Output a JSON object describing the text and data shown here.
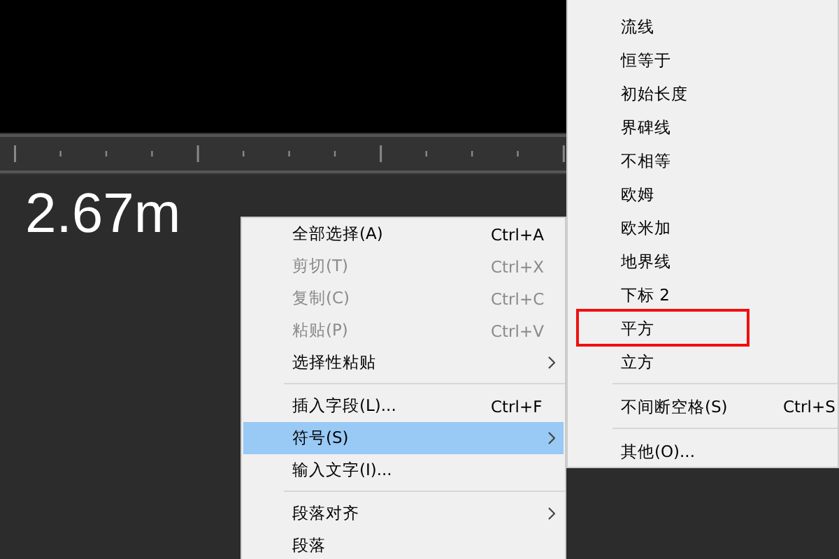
{
  "measurement": "2.67m",
  "context_menu": {
    "items": [
      {
        "kind": "item",
        "label": "全部选择(A)",
        "shortcut": "Ctrl+A",
        "disabled": false,
        "submenu": false,
        "selected": false
      },
      {
        "kind": "item",
        "label": "剪切(T)",
        "shortcut": "Ctrl+X",
        "disabled": true,
        "submenu": false,
        "selected": false
      },
      {
        "kind": "item",
        "label": "复制(C)",
        "shortcut": "Ctrl+C",
        "disabled": true,
        "submenu": false,
        "selected": false
      },
      {
        "kind": "item",
        "label": "粘贴(P)",
        "shortcut": "Ctrl+V",
        "disabled": true,
        "submenu": false,
        "selected": false
      },
      {
        "kind": "item",
        "label": "选择性粘贴",
        "disabled": false,
        "submenu": true,
        "selected": false
      },
      {
        "kind": "separator"
      },
      {
        "kind": "item",
        "label": "插入字段(L)...",
        "shortcut": "Ctrl+F",
        "disabled": false,
        "submenu": false,
        "selected": false
      },
      {
        "kind": "item",
        "label": "符号(S)",
        "disabled": false,
        "submenu": true,
        "selected": true
      },
      {
        "kind": "item",
        "label": "输入文字(I)...",
        "disabled": false,
        "submenu": false,
        "selected": false
      },
      {
        "kind": "separator"
      },
      {
        "kind": "item",
        "label": "段落对齐",
        "disabled": false,
        "submenu": true,
        "selected": false
      },
      {
        "kind": "item",
        "label": "段落",
        "disabled": false,
        "submenu": false,
        "selected": false
      }
    ]
  },
  "symbol_submenu": {
    "items": [
      {
        "kind": "item",
        "label": "流线",
        "selected": false,
        "annotated": false
      },
      {
        "kind": "item",
        "label": "恒等于",
        "selected": false,
        "annotated": false
      },
      {
        "kind": "item",
        "label": "初始长度",
        "selected": false,
        "annotated": false
      },
      {
        "kind": "item",
        "label": "界碑线",
        "selected": false,
        "annotated": false
      },
      {
        "kind": "item",
        "label": "不相等",
        "selected": false,
        "annotated": false
      },
      {
        "kind": "item",
        "label": "欧姆",
        "selected": false,
        "annotated": false
      },
      {
        "kind": "item",
        "label": "欧米加",
        "selected": false,
        "annotated": false
      },
      {
        "kind": "item",
        "label": "地界线",
        "selected": false,
        "annotated": false
      },
      {
        "kind": "item",
        "label": "下标 2",
        "selected": false,
        "annotated": false
      },
      {
        "kind": "item",
        "label": "平方",
        "selected": false,
        "annotated": true
      },
      {
        "kind": "item",
        "label": "立方",
        "selected": false,
        "annotated": false
      },
      {
        "kind": "separator"
      },
      {
        "kind": "item",
        "label": "不间断空格(S)",
        "shortcut": "Ctrl+S",
        "selected": false,
        "annotated": false
      },
      {
        "kind": "separator"
      },
      {
        "kind": "item",
        "label": "其他(O)...",
        "selected": false,
        "annotated": false
      }
    ]
  }
}
